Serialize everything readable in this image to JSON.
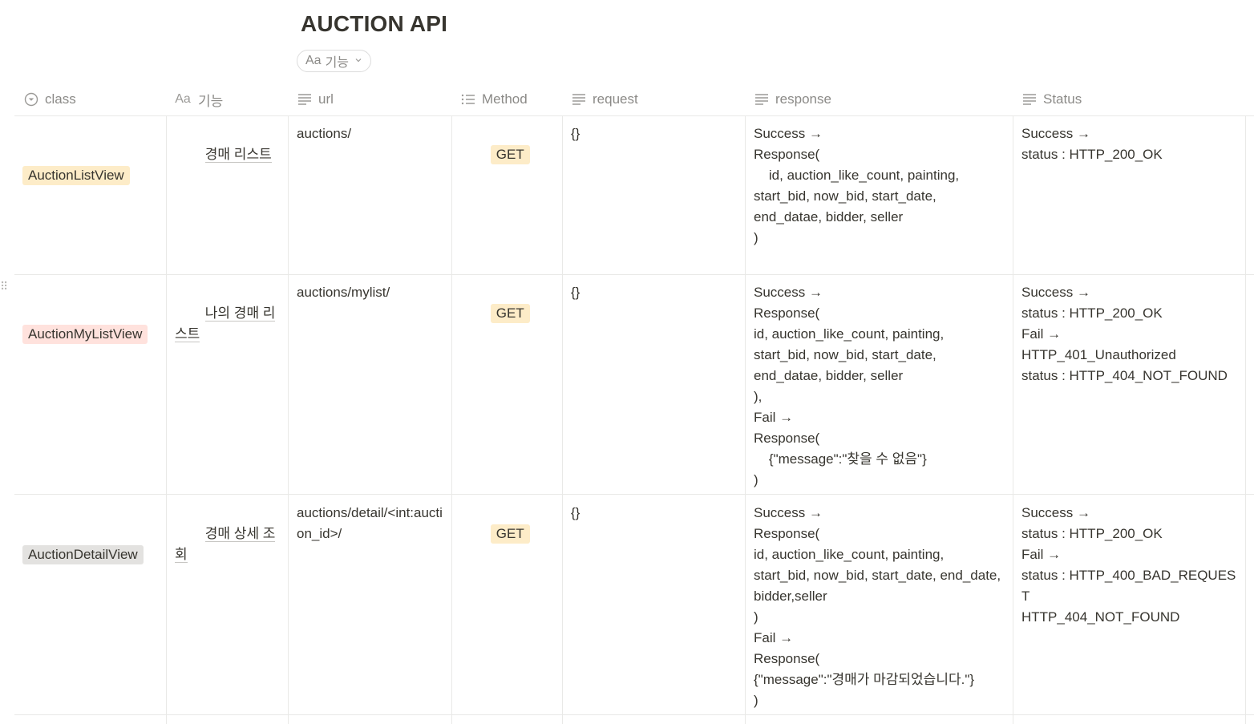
{
  "page": {
    "title": "AUCTION API",
    "view": {
      "icon": "Aa",
      "label": "기능"
    }
  },
  "columns": [
    {
      "label": "class",
      "icon": "select-icon"
    },
    {
      "label": "기능",
      "icon": "title-icon"
    },
    {
      "label": "url",
      "icon": "text-icon"
    },
    {
      "label": "Method",
      "icon": "multi-select-icon"
    },
    {
      "label": "request",
      "icon": "text-icon"
    },
    {
      "label": "response",
      "icon": "text-icon"
    },
    {
      "label": "Status",
      "icon": "text-icon"
    }
  ],
  "colors": {
    "tag_yellow": "#fdecc8",
    "tag_red": "#ffe2dd",
    "tag_gray": "#e3e2e0",
    "method_tag": "#fdecc8"
  },
  "rows": [
    {
      "class": "AuctionListView",
      "class_color": "tag_yellow",
      "feature": "경매 리스트",
      "url": "auctions/",
      "method": "GET",
      "request": "{}",
      "response": "Success →\nResponse(\n    id, auction_like_count, painting,\nstart_bid, now_bid, start_date,\nend_datae, bidder, seller\n)",
      "status": "Success →\nstatus : HTTP_200_OK"
    },
    {
      "class": "AuctionMyListView",
      "class_color": "tag_red",
      "feature": "나의 경매 리스트",
      "url": "auctions/mylist/",
      "method": "GET",
      "request": "{}",
      "response": "Success →\nResponse(\nid, auction_like_count, painting,\nstart_bid, now_bid, start_date,\nend_datae, bidder, seller\n),\nFail →\nResponse(\n    {\"message\":\"찾을 수 없음\"}\n)",
      "status": "Success →\nstatus : HTTP_200_OK\nFail →\nHTTP_401_Unauthorized\nstatus : HTTP_404_NOT_FOUND"
    },
    {
      "class": "AuctionDetailView",
      "class_color": "tag_gray",
      "feature": "경매 상세 조회",
      "url": "auctions/detail/<int:auction_id>/",
      "method": "GET",
      "request": "{}",
      "response": "Success →\nResponse(\nid, auction_like_count, painting,\nstart_bid, now_bid, start_date, end_date,\nbidder,seller\n)\nFail →\nResponse(\n{\"message\":\"경매가 마감되었습니다.\"}\n)",
      "status": "Success →\nstatus : HTTP_200_OK\nFail →\nstatus : HTTP_400_BAD_REQUEST\nHTTP_404_NOT_FOUND"
    }
  ]
}
